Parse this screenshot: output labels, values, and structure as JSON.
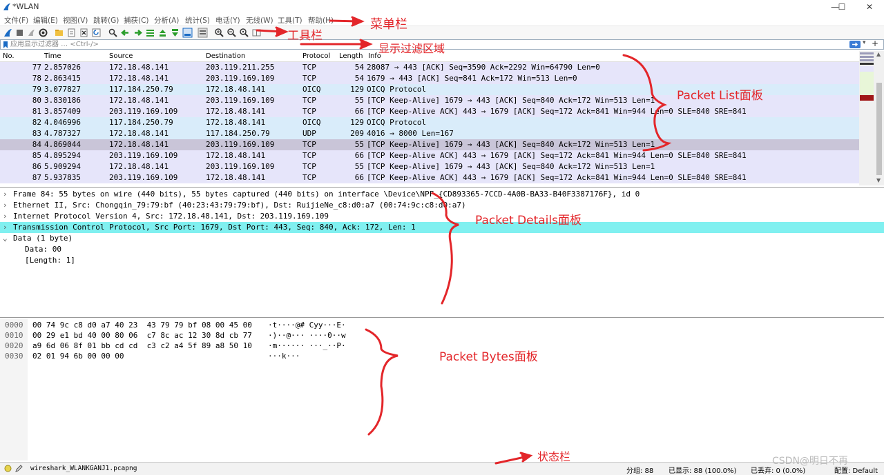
{
  "window": {
    "title": "*WLAN",
    "min": "—",
    "max": "☐",
    "close": "✕"
  },
  "menu": [
    "文件(F)",
    "编辑(E)",
    "视图(V)",
    "跳转(G)",
    "捕获(C)",
    "分析(A)",
    "统计(S)",
    "电话(Y)",
    "无线(W)",
    "工具(T)",
    "帮助(H)"
  ],
  "filter": {
    "placeholder": "应用显示过滤器 … <Ctrl-/>"
  },
  "packet_list": {
    "columns": [
      "No.",
      "Time",
      "Source",
      "Destination",
      "Protocol",
      "Length",
      "Info"
    ],
    "rows": [
      {
        "no": "77",
        "time": "2.857026",
        "src": "172.18.48.141",
        "dst": "203.119.211.255",
        "proto": "TCP",
        "len": "54",
        "info": "28087 → 443 [ACK] Seq=3590 Ack=2292 Win=64790 Len=0"
      },
      {
        "no": "78",
        "time": "2.863415",
        "src": "172.18.48.141",
        "dst": "203.119.169.109",
        "proto": "TCP",
        "len": "54",
        "info": "1679 → 443 [ACK] Seq=841 Ack=172 Win=513 Len=0"
      },
      {
        "no": "79",
        "time": "3.077827",
        "src": "117.184.250.79",
        "dst": "172.18.48.141",
        "proto": "OICQ",
        "len": "129",
        "info": "OICQ Protocol"
      },
      {
        "no": "80",
        "time": "3.830186",
        "src": "172.18.48.141",
        "dst": "203.119.169.109",
        "proto": "TCP",
        "len": "55",
        "info": "[TCP Keep-Alive] 1679 → 443 [ACK] Seq=840 Ack=172 Win=513 Len=1"
      },
      {
        "no": "81",
        "time": "3.857409",
        "src": "203.119.169.109",
        "dst": "172.18.48.141",
        "proto": "TCP",
        "len": "66",
        "info": "[TCP Keep-Alive ACK] 443 → 1679 [ACK] Seq=172 Ack=841 Win=944 Len=0 SLE=840 SRE=841"
      },
      {
        "no": "82",
        "time": "4.046996",
        "src": "117.184.250.79",
        "dst": "172.18.48.141",
        "proto": "OICQ",
        "len": "129",
        "info": "OICQ Protocol"
      },
      {
        "no": "83",
        "time": "4.787327",
        "src": "172.18.48.141",
        "dst": "117.184.250.79",
        "proto": "UDP",
        "len": "209",
        "info": "4016 → 8000 Len=167"
      },
      {
        "no": "84",
        "time": "4.869044",
        "src": "172.18.48.141",
        "dst": "203.119.169.109",
        "proto": "TCP",
        "len": "55",
        "info": "[TCP Keep-Alive] 1679 → 443 [ACK] Seq=840 Ack=172 Win=513 Len=1"
      },
      {
        "no": "85",
        "time": "4.895294",
        "src": "203.119.169.109",
        "dst": "172.18.48.141",
        "proto": "TCP",
        "len": "66",
        "info": "[TCP Keep-Alive ACK] 443 → 1679 [ACK] Seq=172 Ack=841 Win=944 Len=0 SLE=840 SRE=841"
      },
      {
        "no": "86",
        "time": "5.909294",
        "src": "172.18.48.141",
        "dst": "203.119.169.109",
        "proto": "TCP",
        "len": "55",
        "info": "[TCP Keep-Alive] 1679 → 443 [ACK] Seq=840 Ack=172 Win=513 Len=1"
      },
      {
        "no": "87",
        "time": "5.937835",
        "src": "203.119.169.109",
        "dst": "172.18.48.141",
        "proto": "TCP",
        "len": "66",
        "info": "[TCP Keep-Alive ACK] 443 → 1679 [ACK] Seq=172 Ack=841 Win=944 Len=0 SLE=840 SRE=841"
      }
    ],
    "row_colors": [
      "#e6e5fa",
      "#e6e5fa",
      "#d9ecfa",
      "#e6e5fa",
      "#e6e5fa",
      "#d9ecfa",
      "#d9ecfa",
      "#c9c5d8",
      "#e6e5fa",
      "#e6e5fa",
      "#e6e5fa"
    ]
  },
  "details": {
    "rows": [
      {
        "arrow": "›",
        "text": "Frame 84: 55 bytes on wire (440 bits), 55 bytes captured (440 bits) on interface \\Device\\NPF_{CD893365-7CCD-4A0B-BA33-B40F3387176F}, id 0"
      },
      {
        "arrow": "›",
        "text": "Ethernet II, Src: Chongqin_79:79:bf (40:23:43:79:79:bf), Dst: RuijieNe_c8:d0:a7 (00:74:9c:c8:d0:a7)"
      },
      {
        "arrow": "›",
        "text": "Internet Protocol Version 4, Src: 172.18.48.141, Dst: 203.119.169.109"
      },
      {
        "arrow": "›",
        "text": "Transmission Control Protocol, Src Port: 1679, Dst Port: 443, Seq: 840, Ack: 172, Len: 1"
      },
      {
        "arrow": "⌄",
        "text": "Data (1 byte)"
      },
      {
        "arrow": "",
        "text": "Data: 00"
      },
      {
        "arrow": "",
        "text": "[Length: 1]"
      }
    ]
  },
  "bytes": {
    "rows": [
      {
        "off": "0000",
        "hex": "00 74 9c c8 d0 a7 40 23  43 79 79 bf 08 00 45 00",
        "ascii": "·t····@# Cyy···E·"
      },
      {
        "off": "0010",
        "hex": "00 29 e1 bd 40 00 80 06  c7 8c ac 12 30 8d cb 77",
        "ascii": "·)··@··· ····0··w"
      },
      {
        "off": "0020",
        "hex": "a9 6d 06 8f 01 bb cd cd  c3 c2 a4 5f 89 a8 50 10",
        "ascii": "·m······ ···_··P·"
      },
      {
        "off": "0030",
        "hex": "02 01 94 6b 00 00 00",
        "ascii": "···k···"
      }
    ]
  },
  "status": {
    "file": "wireshark_WLANKGANJ1.pcapng",
    "packets": "分组: 88",
    "displayed": "已显示: 88 (100.0%)",
    "dropped": "已丢弃: 0 (0.0%)",
    "profile": "配置: Default"
  },
  "annotations": {
    "menubar": "菜单栏",
    "toolbar": "工具栏",
    "filter": "显示过滤区域",
    "packet_list": "Packet List面板",
    "packet_details": "Packet Details面板",
    "packet_bytes": "Packet Bytes面板",
    "statusbar": "状态栏"
  },
  "watermark": "CSDN@明日不再",
  "colors": {
    "accent_red": "#e3262a",
    "selected_tcp": "#80f0f0",
    "selected_row": "#c9c5d8"
  }
}
